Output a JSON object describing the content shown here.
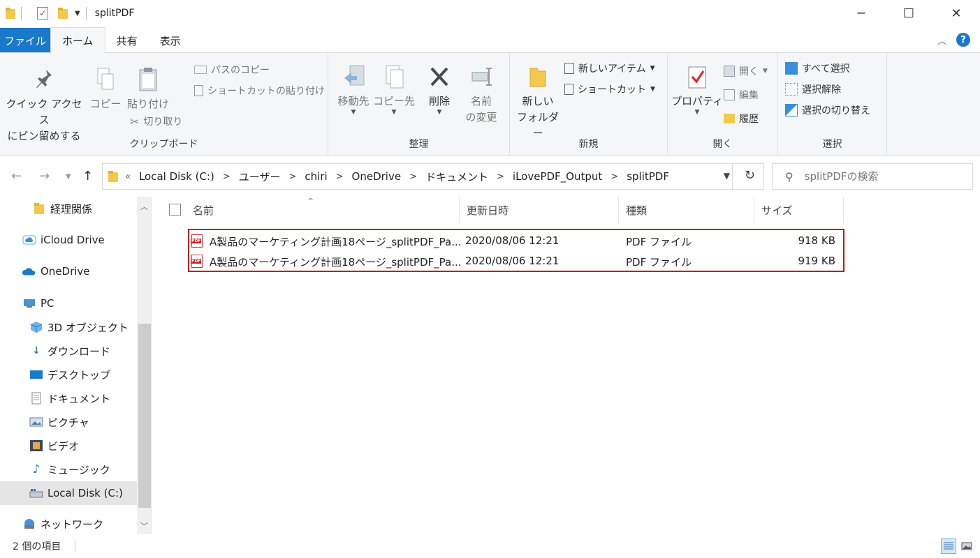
{
  "window": {
    "title": "splitPDF"
  },
  "ribbon_tabs": [
    {
      "label": "ファイル"
    },
    {
      "label": "ホーム"
    },
    {
      "label": "共有"
    },
    {
      "label": "表示"
    }
  ],
  "ribbon": {
    "clipboard": {
      "group_label": "クリップボード",
      "pin_label_1": "クイック アクセス",
      "pin_label_2": "にピン留めする",
      "copy": "コピー",
      "paste": "貼り付け",
      "copy_path": "パスのコピー",
      "paste_shortcut": "ショートカットの貼り付け",
      "cut": "切り取り"
    },
    "organize": {
      "group_label": "整理",
      "move_to": "移動先",
      "copy_to": "コピー先",
      "delete": "削除",
      "rename_1": "名前",
      "rename_2": "の変更"
    },
    "new": {
      "group_label": "新規",
      "new_folder_1": "新しい",
      "new_folder_2": "フォルダー",
      "new_item": "新しいアイテム",
      "shortcut": "ショートカット"
    },
    "open": {
      "group_label": "開く",
      "properties": "プロパティ",
      "open": "開く",
      "edit": "編集",
      "history": "履歴"
    },
    "select": {
      "group_label": "選択",
      "select_all": "すべて選択",
      "select_none": "選択解除",
      "invert": "選択の切り替え"
    }
  },
  "address": {
    "crumbs": [
      "Local Disk (C:)",
      "ユーザー",
      "chiri",
      "OneDrive",
      "ドキュメント",
      "iLovePDF_Output",
      "splitPDF"
    ]
  },
  "search": {
    "placeholder": "splitPDFの検索"
  },
  "nav_pane": {
    "items": [
      {
        "label": "経理関係"
      },
      {
        "label": "iCloud Drive"
      },
      {
        "label": "OneDrive"
      },
      {
        "label": "PC"
      },
      {
        "label": "3D オブジェクト"
      },
      {
        "label": "ダウンロード"
      },
      {
        "label": "デスクトップ"
      },
      {
        "label": "ドキュメント"
      },
      {
        "label": "ピクチャ"
      },
      {
        "label": "ビデオ"
      },
      {
        "label": "ミュージック"
      },
      {
        "label": "Local Disk (C:)"
      },
      {
        "label": "ネットワーク"
      }
    ]
  },
  "file_list": {
    "columns": {
      "name": "名前",
      "date": "更新日時",
      "type": "種類",
      "size": "サイズ"
    },
    "rows": [
      {
        "name": "A製品のマーケティング計画18ページ_splitPDF_Pa...",
        "date": "2020/08/06 12:21",
        "type": "PDF ファイル",
        "size": "918 KB"
      },
      {
        "name": "A製品のマーケティング計画18ページ_splitPDF_Pa...",
        "date": "2020/08/06 12:21",
        "type": "PDF ファイル",
        "size": "919 KB"
      }
    ]
  },
  "status": {
    "item_count": "2 個の項目"
  },
  "colors": {
    "accent": "#1979ca",
    "highlight": "#d01010"
  }
}
